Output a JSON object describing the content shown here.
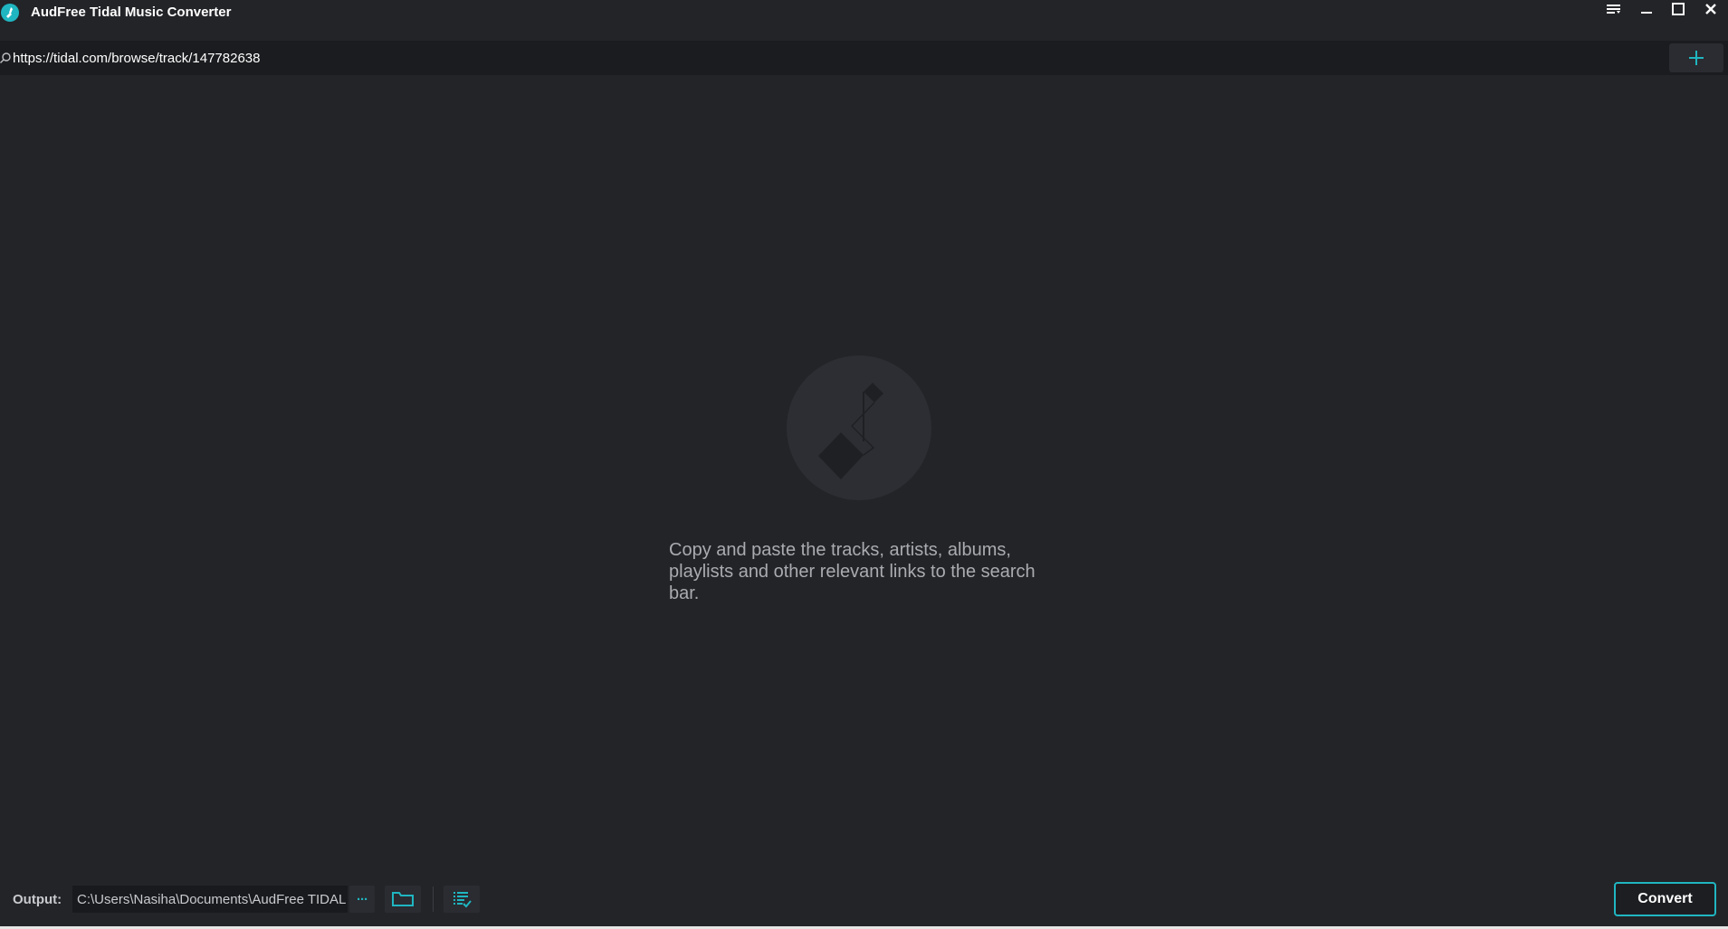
{
  "window": {
    "title": "AudFree Tidal Music Converter"
  },
  "search": {
    "value": "https://tidal.com/browse/track/147782638"
  },
  "empty_state": {
    "message": "Copy and paste the tracks, artists, albums, playlists and other relevant links to the search bar."
  },
  "footer": {
    "output_label": "Output:",
    "output_path": "C:\\Users\\Nasiha\\Documents\\AudFree TIDAL Music Converter\\Converted",
    "more_label": "···",
    "convert_label": "Convert"
  },
  "colors": {
    "accent": "#1fb6c1",
    "background": "#232428",
    "search_bg": "#1b1c1f"
  }
}
